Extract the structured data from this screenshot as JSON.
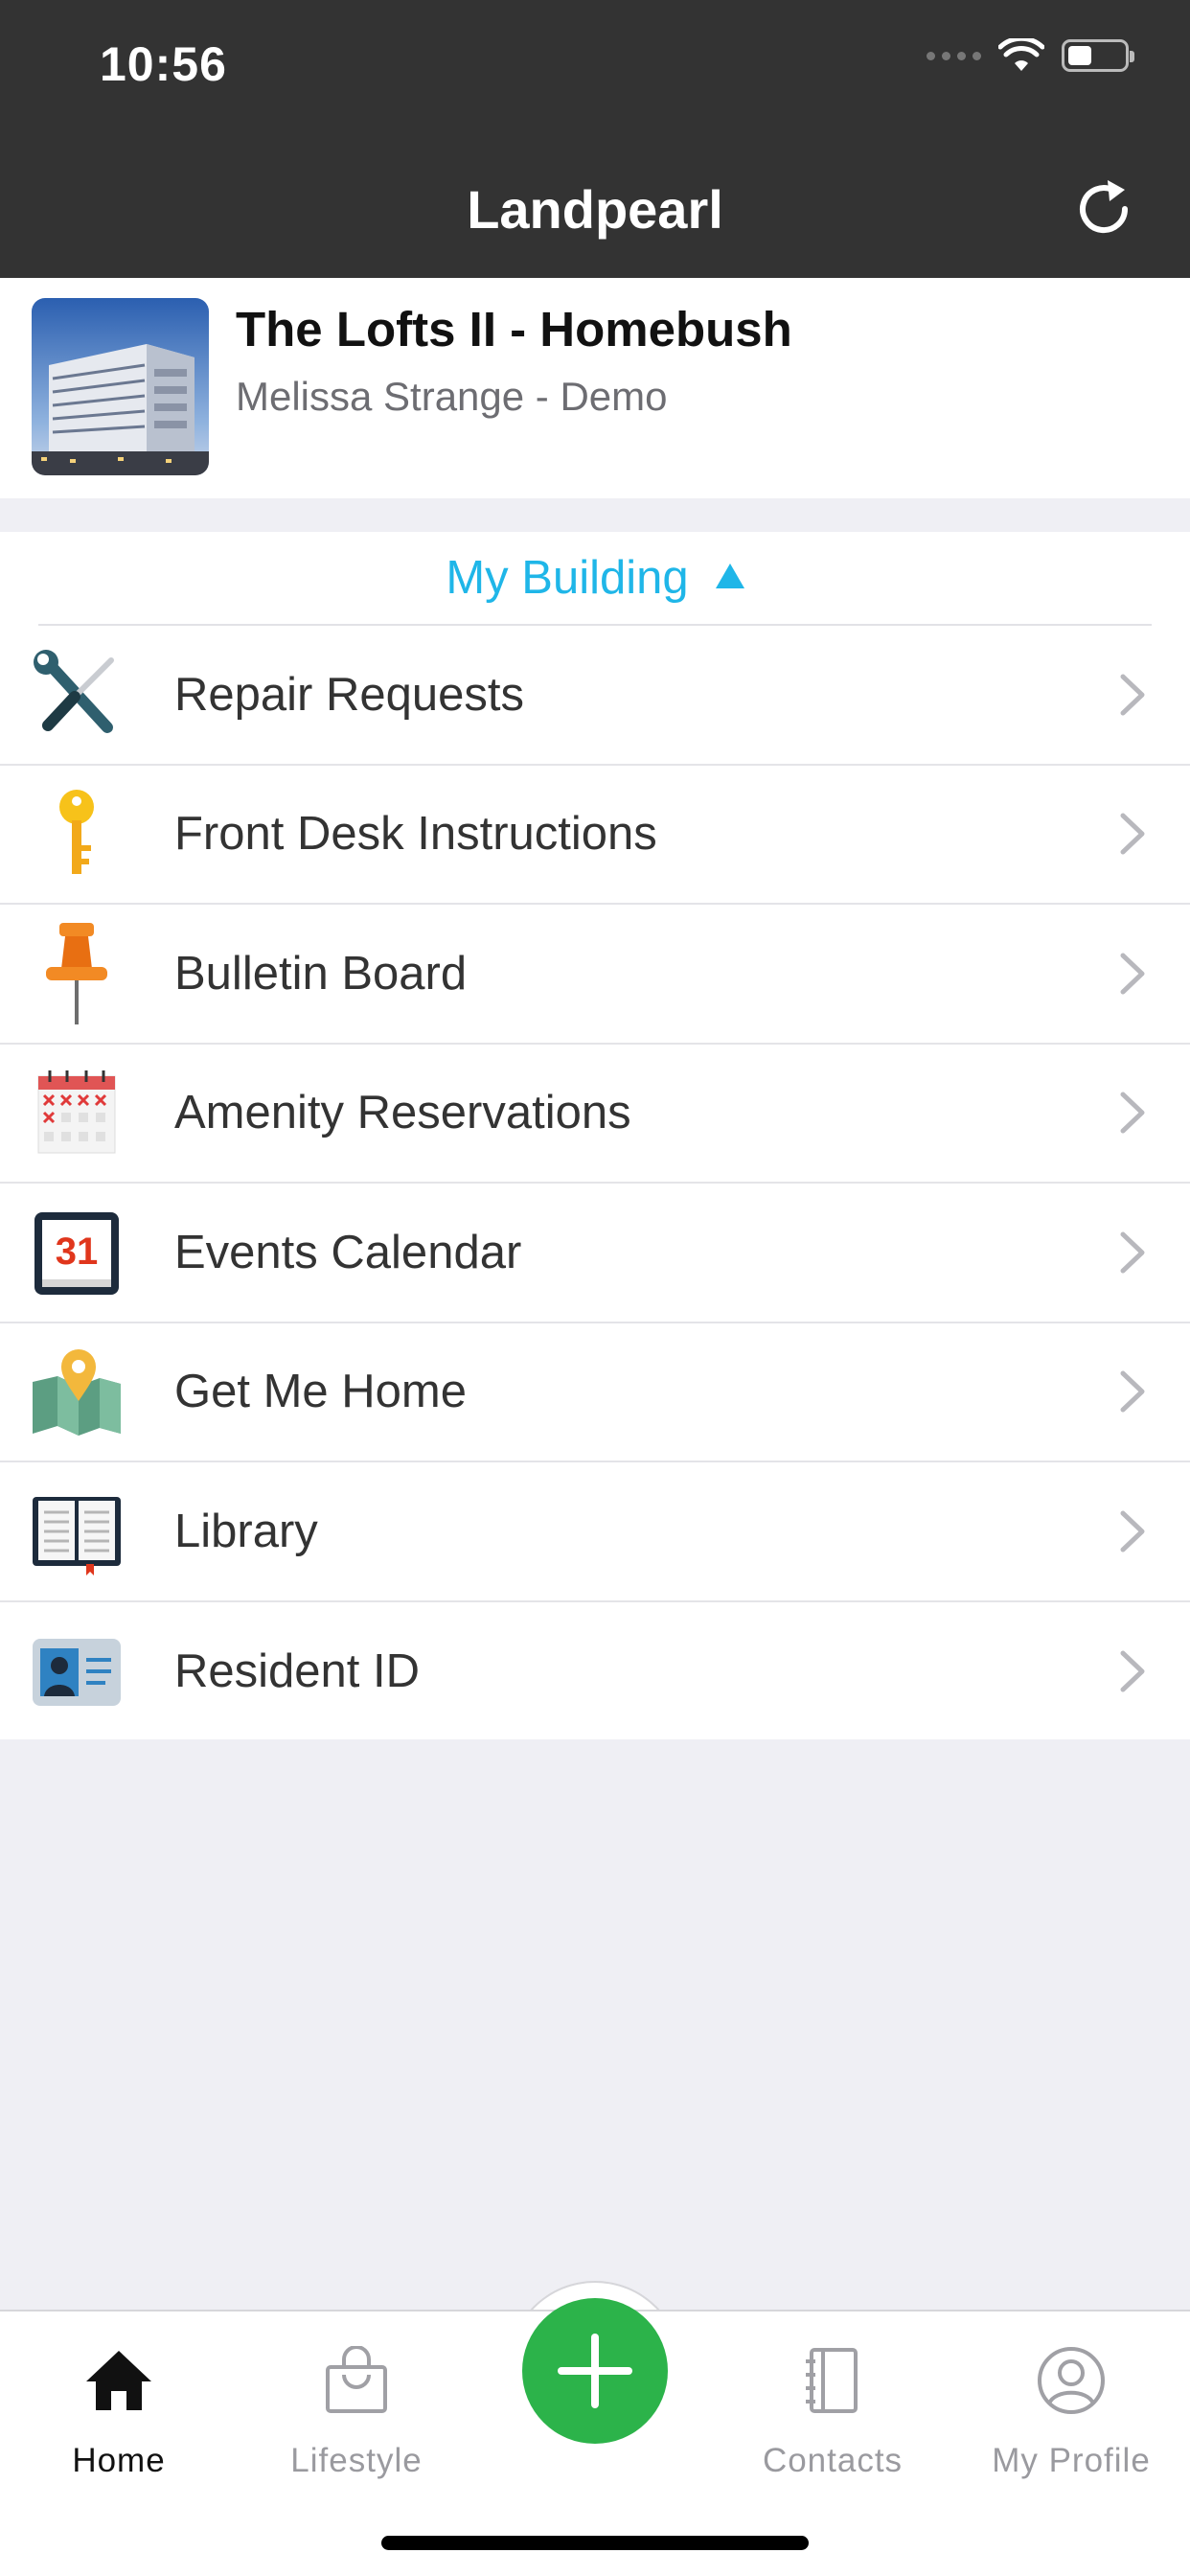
{
  "status_bar": {
    "time": "10:56"
  },
  "nav": {
    "title": "Landpearl",
    "refresh_icon": "refresh-icon"
  },
  "building": {
    "name": "The Lofts II - Homebush",
    "subtitle": "Melissa Strange - Demo"
  },
  "section": {
    "title": "My Building",
    "expanded": true,
    "accent_color": "#1fb6e8"
  },
  "menu": [
    {
      "label": "Repair Requests",
      "icon": "tools-icon"
    },
    {
      "label": "Front Desk Instructions",
      "icon": "key-icon"
    },
    {
      "label": "Bulletin Board",
      "icon": "pushpin-icon"
    },
    {
      "label": "Amenity Reservations",
      "icon": "reservation-calendar-icon"
    },
    {
      "label": "Events Calendar",
      "icon": "calendar-icon",
      "icon_text": "31"
    },
    {
      "label": "Get Me Home",
      "icon": "map-pin-icon"
    },
    {
      "label": "Library",
      "icon": "book-icon"
    },
    {
      "label": "Resident ID",
      "icon": "id-card-icon"
    }
  ],
  "tabbar": {
    "tabs": [
      {
        "label": "Home",
        "icon": "home-icon",
        "active": true
      },
      {
        "label": "Lifestyle",
        "icon": "shopping-bag-icon",
        "active": false
      },
      {
        "label": "Contacts",
        "icon": "notebook-icon",
        "active": false
      },
      {
        "label": "My Profile",
        "icon": "profile-icon",
        "active": false
      }
    ],
    "fab_icon": "plus-icon",
    "fab_color": "#2cb34a"
  }
}
